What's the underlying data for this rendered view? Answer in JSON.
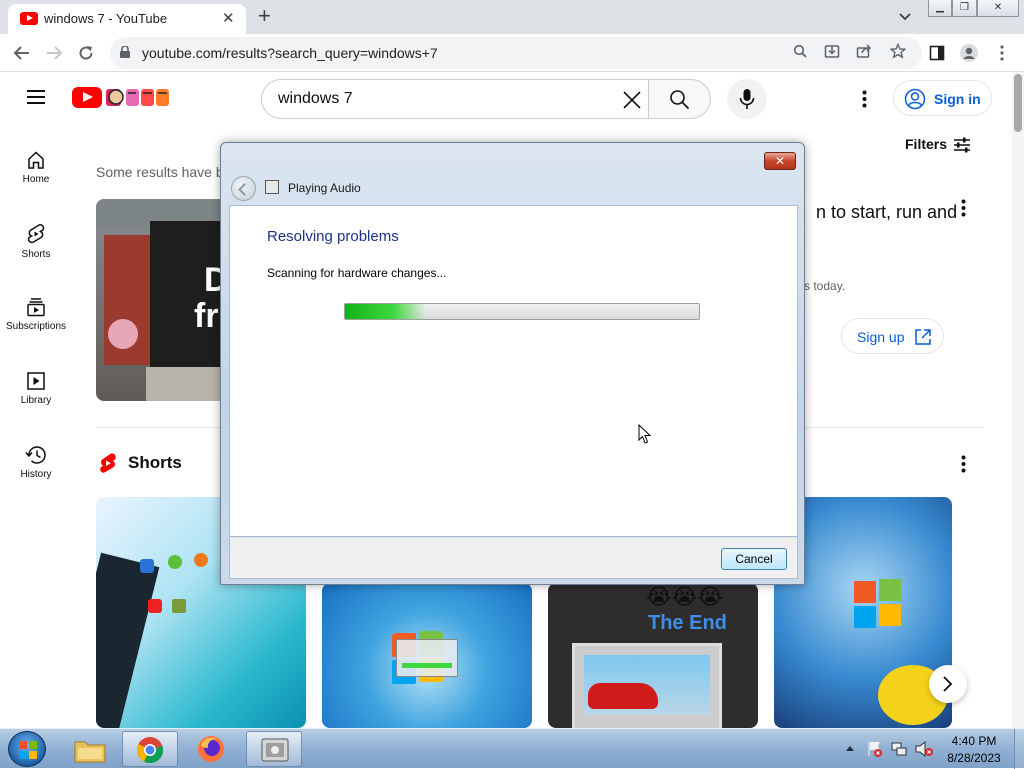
{
  "browser": {
    "tab_title": "windows 7 - YouTube",
    "url": "youtube.com/results?search_query=windows+7"
  },
  "youtube": {
    "search_query": "windows 7",
    "sign_in_label": "Sign in",
    "filters_label": "Filters",
    "guide": [
      {
        "label": "Home",
        "icon": "home-icon"
      },
      {
        "label": "Shorts",
        "icon": "shorts-icon"
      },
      {
        "label": "Subscriptions",
        "icon": "subscriptions-icon"
      },
      {
        "label": "Library",
        "icon": "library-icon"
      },
      {
        "label": "History",
        "icon": "history-icon"
      }
    ],
    "notice_text": "Some results have b",
    "ad_title_fragment": "n to start, run and",
    "ad_desc_fragment": "s today.",
    "ad_signup_label": "Sign up",
    "shorts_heading": "Shorts",
    "thumb_ad_text_1": "D",
    "thumb_ad_text_2": "fr",
    "short_thumb_label": "The End",
    "short_thumb_emoji": "😭😭😭"
  },
  "dialog": {
    "title": "Playing Audio",
    "heading": "Resolving problems",
    "status": "Scanning for hardware changes...",
    "progress_fraction": 0.23,
    "cancel_label": "Cancel"
  },
  "taskbar": {
    "time": "4:40 PM",
    "date": "8/28/2023",
    "buttons": [
      "start-orb",
      "explorer",
      "chrome",
      "firefox",
      "troubleshooter"
    ]
  }
}
